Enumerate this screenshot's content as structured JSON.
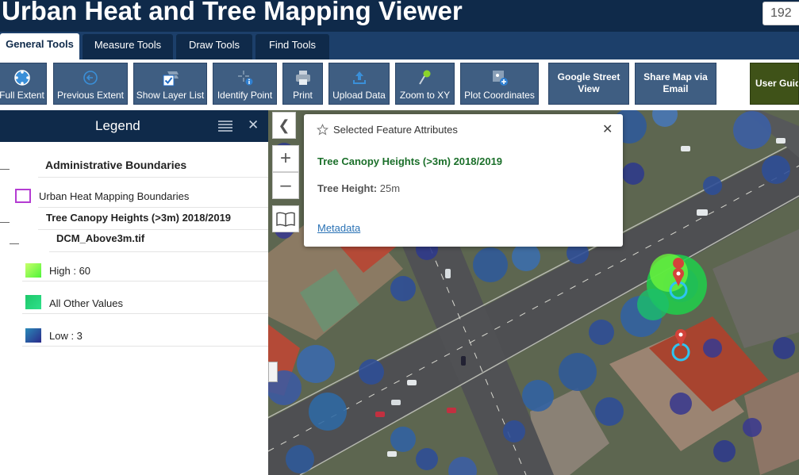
{
  "header": {
    "title": "Urban Heat and Tree Mapping Viewer",
    "search_value": "192"
  },
  "tabs": [
    {
      "label": "General Tools",
      "active": true
    },
    {
      "label": "Measure Tools",
      "active": false
    },
    {
      "label": "Draw Tools",
      "active": false
    },
    {
      "label": "Find Tools",
      "active": false
    }
  ],
  "toolbar": {
    "full_extent": "Full Extent",
    "previous_extent": "Previous Extent",
    "show_layer_list": "Show Layer List",
    "identify_point": "Identify Point",
    "print": "Print",
    "upload_data": "Upload Data",
    "zoom_to_xy": "Zoom to XY",
    "plot_coordinates": "Plot Coordinates",
    "google_street_view": "Google Street View",
    "share_map_email": "Share Map via Email",
    "user_guide": "User Guide"
  },
  "legend": {
    "title": "Legend",
    "group_admin": "Administrative Boundaries",
    "layer_heat_boundaries": "Urban Heat Mapping Boundaries",
    "group_canopy": "Tree Canopy Heights (>3m) 2018/2019",
    "raster_name": "DCM_Above3m.tif",
    "items": [
      {
        "label": "High : 60",
        "color": "#7fff3a"
      },
      {
        "label": "All Other Values",
        "color": "#1fcf7a"
      },
      {
        "label": "Low : 3",
        "color": "#2a2a8a"
      }
    ],
    "boundary_color": "#b43cd2"
  },
  "popup": {
    "header": "Selected Feature Attributes",
    "layer_name": "Tree Canopy Heights (>3m) 2018/2019",
    "field_label": "Tree Height:",
    "field_value": "25m",
    "metadata_link": "Metadata"
  },
  "colors": {
    "header_bg": "#0f2a4a",
    "tool_bg": "#3f5e82",
    "guide_bg": "#3f5218",
    "popup_layer": "#1b6f2a",
    "link": "#2a72b5"
  }
}
